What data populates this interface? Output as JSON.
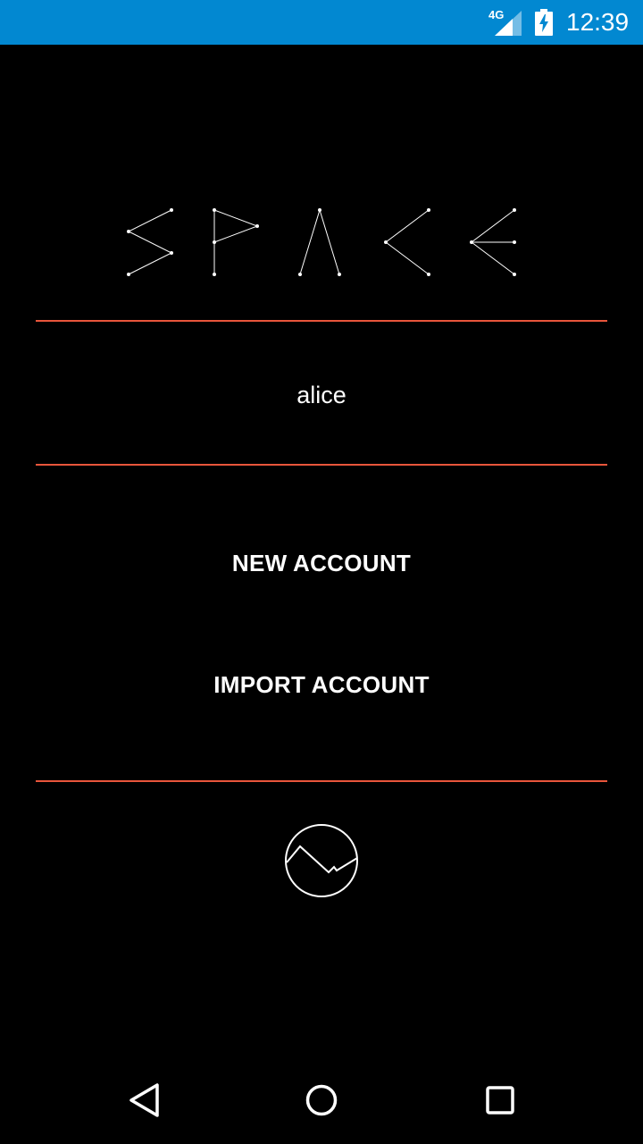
{
  "status_bar": {
    "network": "4G",
    "time": "12:39",
    "color": "#0288d1"
  },
  "logo": {
    "icon": "space-constellation-logo"
  },
  "account": {
    "username": "alice"
  },
  "actions": {
    "new_account": "NEW ACCOUNT",
    "import_account": "IMPORT ACCOUNT"
  },
  "theme": {
    "accent": "#e8553b",
    "background": "#000000",
    "text": "#ffffff"
  },
  "icons": {
    "bottom_icon": "wave-circle-icon",
    "nav_back": "back-icon",
    "nav_home": "home-icon",
    "nav_recents": "recents-icon"
  }
}
